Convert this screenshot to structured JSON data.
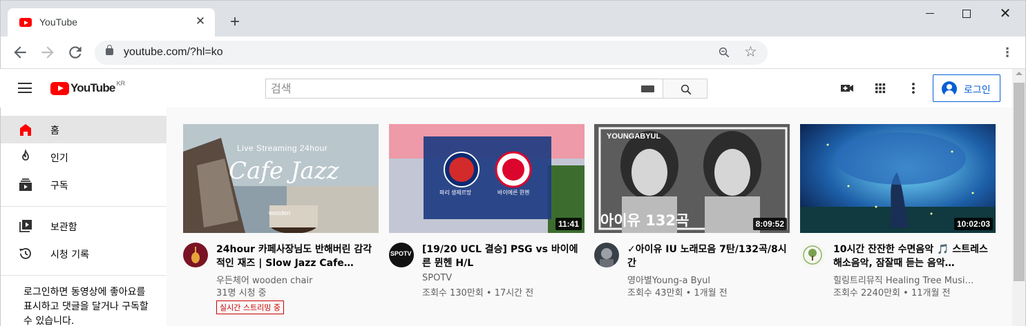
{
  "browser": {
    "tab_title": "YouTube",
    "url": "youtube.com/?hl=ko"
  },
  "header": {
    "logo_text": "YouTube",
    "logo_region": "KR",
    "search_placeholder": "검색",
    "login_label": "로그인"
  },
  "sidebar": {
    "items": [
      {
        "label": "홈",
        "icon": "home-icon",
        "active": true
      },
      {
        "label": "인기",
        "icon": "trending-fire-icon",
        "active": false
      },
      {
        "label": "구독",
        "icon": "subscriptions-icon",
        "active": false
      },
      {
        "label": "보관함",
        "icon": "library-icon",
        "active": false
      },
      {
        "label": "시청 기록",
        "icon": "history-icon",
        "active": false
      }
    ],
    "promo_text": "로그인하면 동영상에 좋아요를 표시하고 댓글을 달거나 구독할 수 있습니다."
  },
  "videos": [
    {
      "title": "24hour 카페사장님도 반해버린 감각적인 재즈 | Slow Jazz Cafe…",
      "channel": "우든체어 wooden chair",
      "meta": "31명 시청 중",
      "live_badge": "실시간 스트리밍 중",
      "thumb_line1": "Live Streaming 24hour",
      "thumb_line2": "Cafe Jazz",
      "thumb_brand": "wooden"
    },
    {
      "title": "[19/20 UCL 결승] PSG vs 바이에른 뮌헨 H/L",
      "channel": "SPOTV",
      "meta": "조회수 130만회 • 17시간 전",
      "duration": "11:41",
      "thumb_team1": "파리 생제르망",
      "thumb_team2": "바이에른 뮌헨",
      "avatar_text": "SPOTV"
    },
    {
      "title": "✓아이유 IU 노래모음 7탄/132곡/8시간",
      "channel": "영아별Young-a Byul",
      "meta": "조회수 43만회 • 1개월 전",
      "duration": "8:09:52",
      "thumb_brand": "YOUNGABYUL",
      "thumb_caption": "아이유 132곡"
    },
    {
      "title": "10시간 잔잔한 수면음악 🎵 스트레스 해소음악, 잠잘때 듣는 음악…",
      "channel": "힐링트리뮤직 Healing Tree Musi…",
      "meta": "조회수 2240만회 • 11개월 전",
      "duration": "10:02:03"
    }
  ],
  "colors": {
    "youtube_red": "#ff0000",
    "link_blue": "#065fd4",
    "live_red": "#cc0000"
  }
}
